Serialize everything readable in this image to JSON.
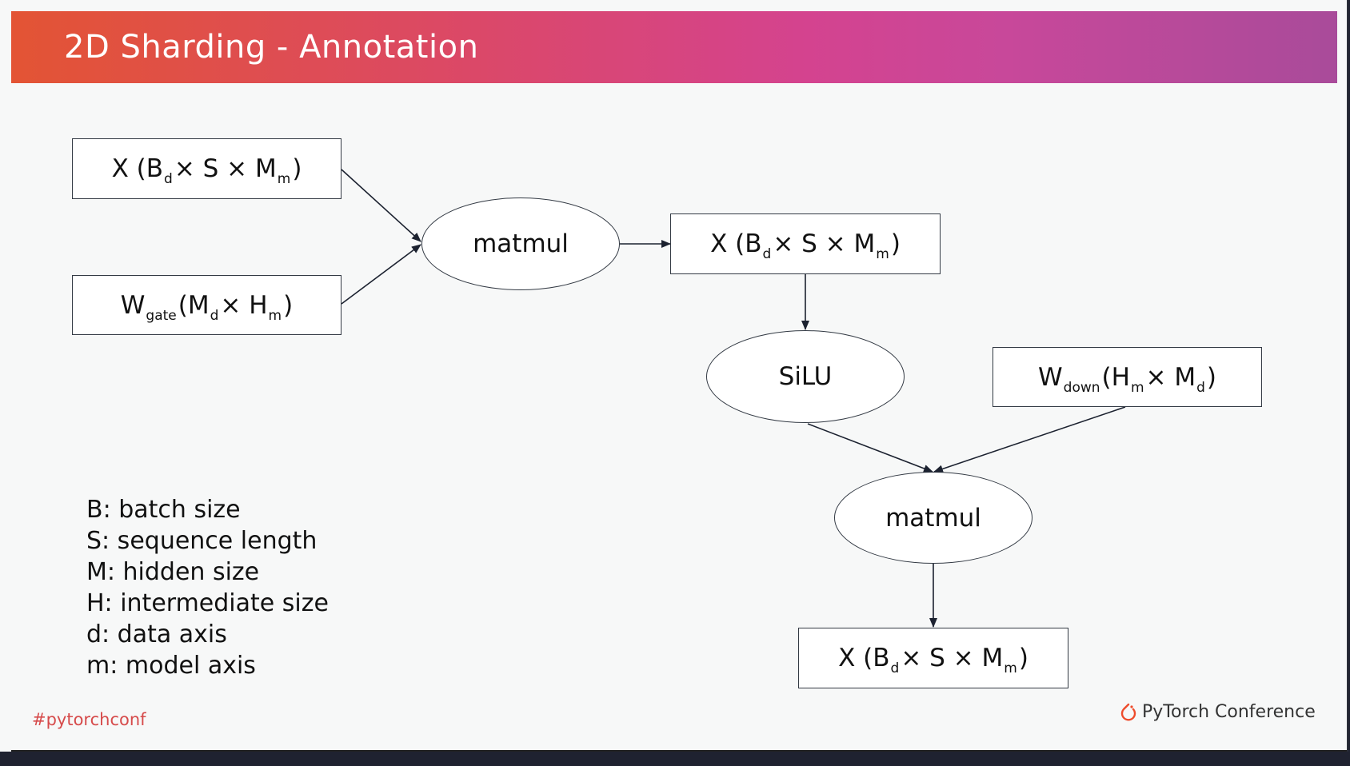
{
  "title": "2D Sharding - Annotation",
  "nodes": {
    "x_input": {
      "pre": "X (B",
      "sub1": "d",
      "mid": " × S × M",
      "sub2": "m",
      "post": ")"
    },
    "w_gate": {
      "pre": "W",
      "sub1": "gate",
      "mid": " (M",
      "sub2": "d",
      "mid2": " × H",
      "sub3": "m",
      "post": ")"
    },
    "matmul_1": "matmul",
    "x_mid": {
      "pre": "X (B",
      "sub1": "d",
      "mid": " × S × M",
      "sub2": "m",
      "post": ")"
    },
    "silu": "SiLU",
    "w_down": {
      "pre": "W",
      "sub1": "down",
      "mid": " (H",
      "sub2": "m",
      "mid2": " × M",
      "sub3": "d",
      "post": ")"
    },
    "matmul_2": "matmul",
    "x_output": {
      "pre": "X (B",
      "sub1": "d",
      "mid": " × S × M",
      "sub2": "m",
      "post": ")"
    }
  },
  "legend": [
    "B: batch size",
    "S: sequence length",
    "M: hidden size",
    "H: intermediate size",
    "d: data axis",
    "m: model axis"
  ],
  "footer": {
    "hashtag": "#pytorchconf",
    "brand": "PyTorch Conference"
  },
  "colors": {
    "title_gradient": [
      "#e35434",
      "#d4438f",
      "#a94b9a"
    ],
    "hashtag": "#d64b4b",
    "pytorch_logo": "#ee4c2c"
  },
  "icons": [
    "pytorch-flame-icon"
  ]
}
